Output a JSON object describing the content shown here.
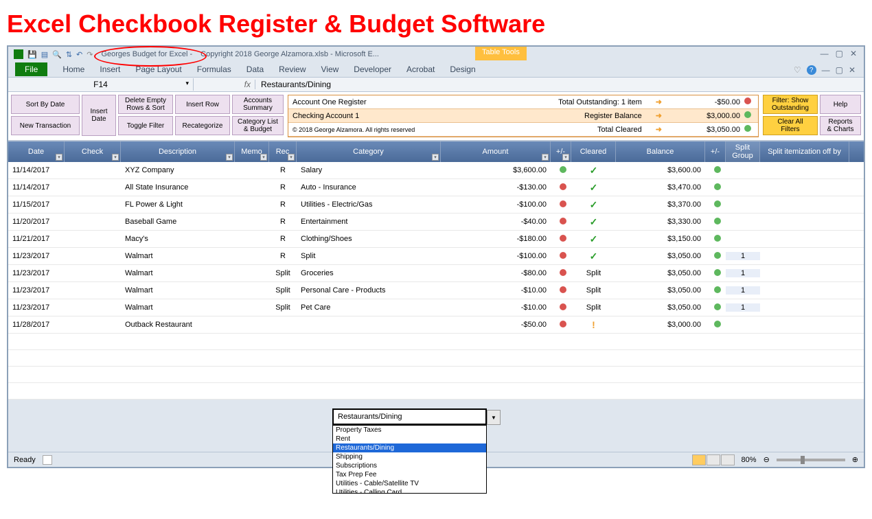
{
  "banner_title": "Excel Checkbook Register & Budget Software",
  "window_title_circled": "Georges Budget for Excel -",
  "window_title_rest": "Copyright 2018 George Alzamora.xlsb - Microsoft E...",
  "tab_tools_label": "Table Tools",
  "ribbon": {
    "file": "File",
    "tabs": [
      "Home",
      "Insert",
      "Page Layout",
      "Formulas",
      "Data",
      "Review",
      "View",
      "Developer",
      "Acrobat",
      "Design"
    ]
  },
  "name_box": "F14",
  "fx_label": "fx",
  "formula_value": "Restaurants/Dining",
  "toolbar": {
    "sort_by_date": "Sort By Date",
    "new_transaction": "New Transaction",
    "insert_date": "Insert\nDate",
    "delete_empty": "Delete Empty\nRows & Sort",
    "toggle_filter": "Toggle Filter",
    "insert_row": "Insert Row",
    "recategorize": "Recategorize",
    "accounts_summary": "Accounts\nSummary",
    "category_list": "Category List\n& Budget",
    "filter_show": "Filter: Show\nOutstanding",
    "clear_filters": "Clear All\nFilters",
    "help": "Help",
    "reports": "Reports\n& Charts"
  },
  "summary": {
    "row1_a": "Account One Register",
    "row1_b": "Total Outstanding: 1 item",
    "row1_c": "-$50.00",
    "row2_a": "Checking Account 1",
    "row2_b": "Register Balance",
    "row2_c": "$3,000.00",
    "row3_a": "© 2018 George Alzamora. All rights reserved",
    "row3_b": "Total Cleared",
    "row3_c": "$3,050.00"
  },
  "columns": [
    "Date",
    "Check",
    "Description",
    "Memo",
    "Rec",
    "Category",
    "Amount",
    "+/-",
    "Cleared",
    "Balance",
    "+/-",
    "Split Group",
    "Split itemization off by"
  ],
  "rows": [
    {
      "date": "11/14/2017",
      "check": "",
      "desc": "XYZ Company",
      "memo": "",
      "rec": "R",
      "cat": "Salary",
      "amt": "$3,600.00",
      "pm1": "g",
      "clr": "check",
      "bal": "$3,600.00",
      "pm2": "g",
      "sg": "",
      "si": ""
    },
    {
      "date": "11/14/2017",
      "check": "",
      "desc": "All State Insurance",
      "memo": "",
      "rec": "R",
      "cat": "Auto - Insurance",
      "amt": "-$130.00",
      "pm1": "r",
      "clr": "check",
      "bal": "$3,470.00",
      "pm2": "g",
      "sg": "",
      "si": ""
    },
    {
      "date": "11/15/2017",
      "check": "",
      "desc": "FL Power & Light",
      "memo": "",
      "rec": "R",
      "cat": "Utilities - Electric/Gas",
      "amt": "-$100.00",
      "pm1": "r",
      "clr": "check",
      "bal": "$3,370.00",
      "pm2": "g",
      "sg": "",
      "si": ""
    },
    {
      "date": "11/20/2017",
      "check": "",
      "desc": "Baseball Game",
      "memo": "",
      "rec": "R",
      "cat": "Entertainment",
      "amt": "-$40.00",
      "pm1": "r",
      "clr": "check",
      "bal": "$3,330.00",
      "pm2": "g",
      "sg": "",
      "si": ""
    },
    {
      "date": "11/21/2017",
      "check": "",
      "desc": "Macy's",
      "memo": "",
      "rec": "R",
      "cat": "Clothing/Shoes",
      "amt": "-$180.00",
      "pm1": "r",
      "clr": "check",
      "bal": "$3,150.00",
      "pm2": "g",
      "sg": "",
      "si": ""
    },
    {
      "date": "11/23/2017",
      "check": "",
      "desc": "Walmart",
      "memo": "",
      "rec": "R",
      "cat": "Split",
      "amt": "-$100.00",
      "pm1": "r",
      "clr": "check",
      "bal": "$3,050.00",
      "pm2": "g",
      "sg": "1",
      "si": ""
    },
    {
      "date": "11/23/2017",
      "check": "",
      "desc": "Walmart",
      "memo": "",
      "rec": "Split",
      "cat": "Groceries",
      "amt": "-$80.00",
      "pm1": "r",
      "clr": "Split",
      "bal": "$3,050.00",
      "pm2": "g",
      "sg": "1",
      "si": ""
    },
    {
      "date": "11/23/2017",
      "check": "",
      "desc": "Walmart",
      "memo": "",
      "rec": "Split",
      "cat": "Personal Care - Products",
      "amt": "-$10.00",
      "pm1": "r",
      "clr": "Split",
      "bal": "$3,050.00",
      "pm2": "g",
      "sg": "1",
      "si": ""
    },
    {
      "date": "11/23/2017",
      "check": "",
      "desc": "Walmart",
      "memo": "",
      "rec": "Split",
      "cat": "Pet Care",
      "amt": "-$10.00",
      "pm1": "r",
      "clr": "Split",
      "bal": "$3,050.00",
      "pm2": "g",
      "sg": "1",
      "si": ""
    },
    {
      "date": "11/28/2017",
      "check": "",
      "desc": "Outback Restaurant",
      "memo": "",
      "rec": "",
      "cat": "",
      "amt": "-$50.00",
      "pm1": "r",
      "clr": "exclaim",
      "bal": "$3,000.00",
      "pm2": "g",
      "sg": "",
      "si": ""
    }
  ],
  "dropdown": {
    "selected_value": "Restaurants/Dining",
    "items": [
      "Property Taxes",
      "Rent",
      "Restaurants/Dining",
      "Shipping",
      "Subscriptions",
      "Tax Prep Fee",
      "Utilities - Cable/Satellite TV",
      "Utilities - Calling Card"
    ],
    "highlighted_index": 2
  },
  "status": {
    "ready": "Ready",
    "zoom": "80%"
  }
}
